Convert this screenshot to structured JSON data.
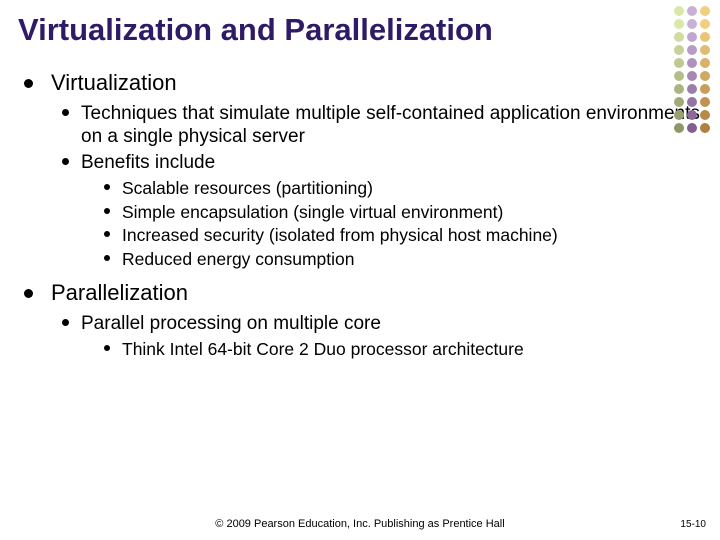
{
  "title": "Virtualization and Parallelization",
  "sections": [
    {
      "heading": "Virtualization",
      "items": [
        {
          "text": "Techniques that simulate multiple self-contained application environments on a single physical server"
        },
        {
          "text": "Benefits include",
          "sub": [
            "Scalable resources (partitioning)",
            "Simple encapsulation (single virtual environment)",
            "Increased security (isolated from physical host machine)",
            "Reduced energy consumption"
          ]
        }
      ]
    },
    {
      "heading": "Parallelization",
      "items": [
        {
          "text": "Parallel processing on multiple core",
          "sub": [
            "Think Intel 64-bit Core 2 Duo processor architecture"
          ]
        }
      ]
    }
  ],
  "footer": "© 2009 Pearson Education, Inc. Publishing as Prentice Hall",
  "page": "15-10",
  "deco_colors": {
    "c1": [
      "#d9e8a8",
      "#d9e8a8",
      "#d0dca0",
      "#c7d298",
      "#bec890",
      "#b5be88",
      "#acb480",
      "#a3aa78",
      "#9aa070",
      "#919668"
    ],
    "c2": [
      "#c9b0d8",
      "#c9b0d8",
      "#c0a6cf",
      "#b79cc6",
      "#ae92bd",
      "#a588b4",
      "#9c7eab",
      "#9374a2",
      "#8a6a99",
      "#816090"
    ],
    "c3": [
      "#f0d080",
      "#f0d080",
      "#e8c678",
      "#e0bc70",
      "#d8b268",
      "#d0a860",
      "#c89e58",
      "#c09450",
      "#b88a48",
      "#b08040"
    ]
  }
}
